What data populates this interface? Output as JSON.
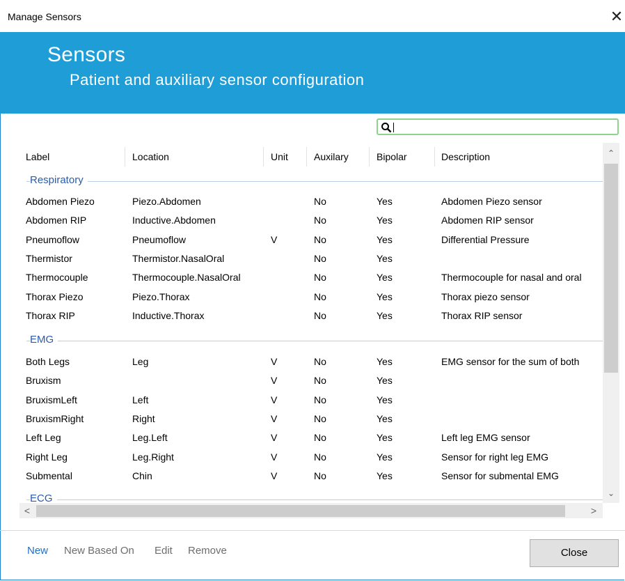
{
  "window": {
    "title": "Manage Sensors",
    "close_glyph": "✕"
  },
  "banner": {
    "title": "Sensors",
    "subtitle": "Patient and auxiliary sensor configuration"
  },
  "search": {
    "value": "",
    "icon": "search-icon"
  },
  "columns": [
    "Label",
    "Location",
    "Unit",
    "Auxilary",
    "Bipolar",
    "Description"
  ],
  "groups": [
    {
      "name": "Respiratory",
      "rows": [
        [
          "Abdomen Piezo",
          "Piezo.Abdomen",
          "",
          "No",
          "Yes",
          "Abdomen Piezo sensor"
        ],
        [
          "Abdomen RIP",
          "Inductive.Abdomen",
          "",
          "No",
          "Yes",
          "Abdomen RIP sensor"
        ],
        [
          "Pneumoflow",
          "Pneumoflow",
          "V",
          "No",
          "Yes",
          "Differential Pressure"
        ],
        [
          "Thermistor",
          "Thermistor.NasalOral",
          "",
          "No",
          "Yes",
          ""
        ],
        [
          "Thermocouple",
          "Thermocouple.NasalOral",
          "",
          "No",
          "Yes",
          "Thermocouple for nasal and oral"
        ],
        [
          "Thorax Piezo",
          "Piezo.Thorax",
          "",
          "No",
          "Yes",
          "Thorax piezo sensor"
        ],
        [
          "Thorax RIP",
          "Inductive.Thorax",
          "",
          "No",
          "Yes",
          "Thorax RIP sensor"
        ]
      ]
    },
    {
      "name": "EMG",
      "rows": [
        [
          "Both Legs",
          "Leg",
          "V",
          "No",
          "Yes",
          "EMG sensor for the sum of both"
        ],
        [
          "Bruxism",
          "",
          "V",
          "No",
          "Yes",
          ""
        ],
        [
          "BruxismLeft",
          "Left",
          "V",
          "No",
          "Yes",
          ""
        ],
        [
          "BruxismRight",
          "Right",
          "V",
          "No",
          "Yes",
          ""
        ],
        [
          "Left Leg",
          "Leg.Left",
          "V",
          "No",
          "Yes",
          "Left leg EMG sensor"
        ],
        [
          "Right Leg",
          "Leg.Right",
          "V",
          "No",
          "Yes",
          "Sensor for right leg EMG"
        ],
        [
          "Submental",
          "Chin",
          "V",
          "No",
          "Yes",
          "Sensor for submental EMG"
        ]
      ]
    },
    {
      "name": "ECG",
      "rows": []
    }
  ],
  "footer": {
    "actions": [
      {
        "label": "New",
        "color": "#1f6fc5"
      },
      {
        "label": "New Based On",
        "color": "#6d6d6d"
      },
      {
        "label": "Edit",
        "color": "#6d6d6d"
      },
      {
        "label": "Remove",
        "color": "#6d6d6d"
      }
    ],
    "close_label": "Close"
  },
  "colors": {
    "banner": "#1f9dd6",
    "group_label": "#2a5caa",
    "search_border": "#8fd28f"
  }
}
